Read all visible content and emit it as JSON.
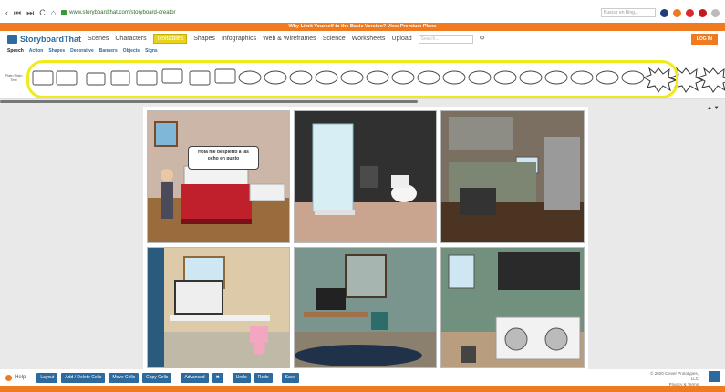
{
  "browser": {
    "nav_glyphs": [
      "‹",
      "⏮",
      "⏭",
      "C",
      "⌂"
    ],
    "url": "www.storyboardthat.com/storyboard-creator",
    "search_placeholder": "Buscar en Bing..."
  },
  "promo": {
    "text": "Why Limit Yourself to the Basic Version?   View Premium Plans"
  },
  "header": {
    "logo": "StoryboardThat",
    "items": [
      "Scenes",
      "Characters",
      "Textables",
      "Shapes",
      "Infographics",
      "Web & Wireframes",
      "Science",
      "Worksheets",
      "Upload"
    ],
    "search_placeholder": "Search...",
    "login": "LOG IN"
  },
  "subnav": [
    "Speech",
    "Action",
    "Shapes",
    "Decorative",
    "Banners",
    "Objects",
    "Signs"
  ],
  "palette": {
    "plain_label": "Plain Plain Text"
  },
  "cells": [
    {
      "name": "bedroom",
      "bubble": "Hola me despierto a las ocho en punto"
    },
    {
      "name": "bathroom"
    },
    {
      "name": "kitchen"
    },
    {
      "name": "office"
    },
    {
      "name": "study"
    },
    {
      "name": "laundry"
    }
  ],
  "bottom": {
    "help": "Help",
    "buttons": [
      "Layout",
      "Add / Delete Cells",
      "Move Cells",
      "Copy Cells",
      "Advanced",
      "✖",
      "Undo",
      "Redo",
      "Save"
    ],
    "copyright": "© 2020 Clever Prototypes, LLC",
    "privacy": "Privacy & Terms"
  },
  "colors": {
    "brand": "#2d6b9f",
    "accent": "#f07a20",
    "highlight": "#f0ea1a"
  }
}
